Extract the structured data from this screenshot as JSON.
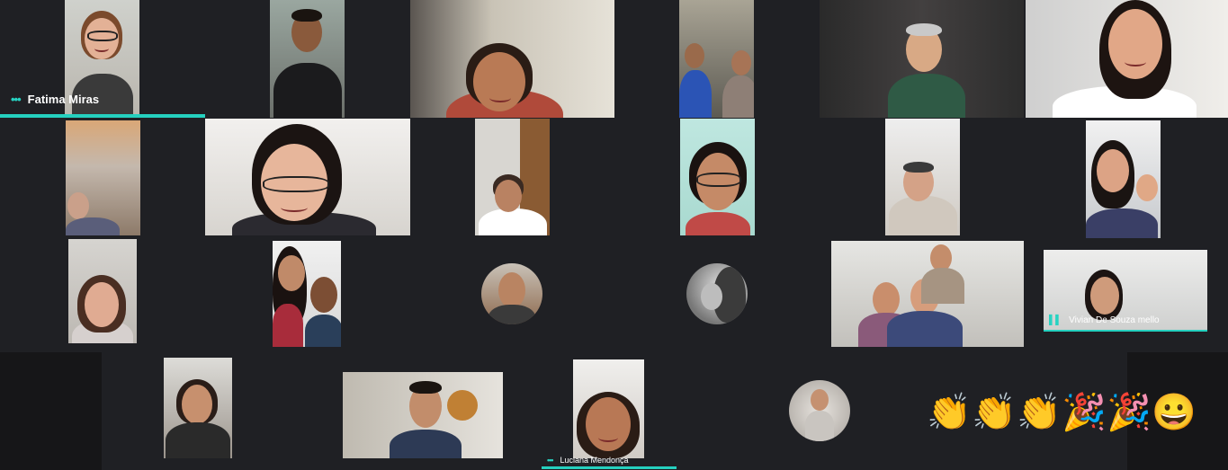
{
  "participants": {
    "fatima": {
      "name": "Fatima Miras"
    },
    "vivian": {
      "name": "Vivian De Souza mello"
    },
    "luciana": {
      "name": "Luciana Mendonça"
    }
  },
  "reactions": [
    "👏",
    "👏",
    "👏",
    "🎉",
    "🎉",
    "😀"
  ],
  "colors": {
    "accent": "#25d0bf",
    "background": "#1f2024"
  }
}
